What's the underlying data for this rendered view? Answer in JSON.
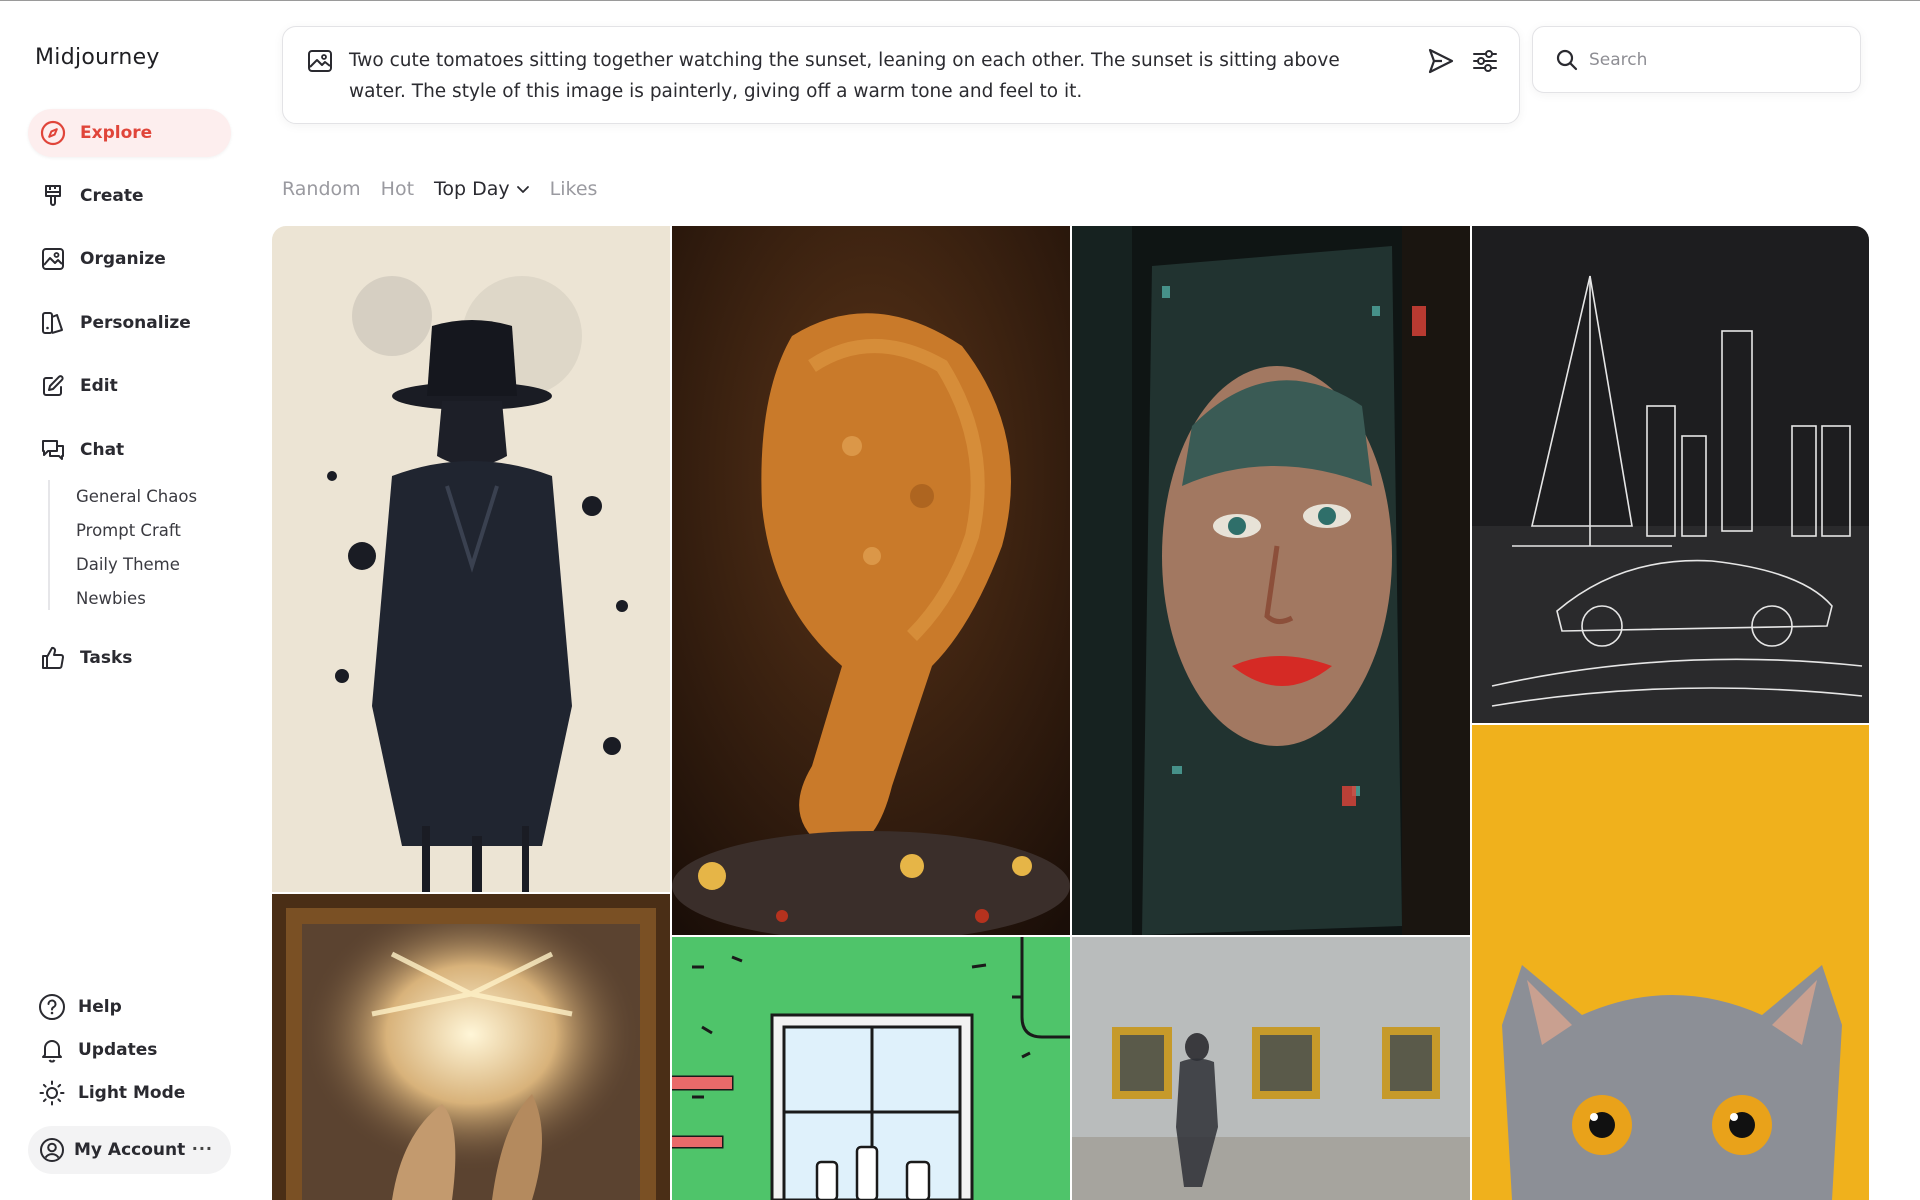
{
  "brand": "Midjourney",
  "nav": [
    {
      "label": "Explore",
      "icon": "compass-icon",
      "active": true
    },
    {
      "label": "Create",
      "icon": "brush-icon"
    },
    {
      "label": "Organize",
      "icon": "image-icon"
    },
    {
      "label": "Personalize",
      "icon": "personalize-icon"
    },
    {
      "label": "Edit",
      "icon": "edit-icon"
    },
    {
      "label": "Chat",
      "icon": "chat-icon"
    }
  ],
  "chat_rooms": [
    "General Chaos",
    "Prompt Craft",
    "Daily Theme",
    "Newbies"
  ],
  "tasks": {
    "label": "Tasks",
    "icon": "thumbs-up-icon"
  },
  "footer": [
    {
      "label": "Help",
      "icon": "help-icon"
    },
    {
      "label": "Updates",
      "icon": "bell-icon"
    },
    {
      "label": "Light Mode",
      "icon": "sun-icon"
    }
  ],
  "account": {
    "label": "My Account",
    "more": "···",
    "icon": "user-circle-icon"
  },
  "prompt": {
    "text": "Two cute tomatoes sitting together watching the sunset, leaning on each other. The sunset is sitting above water. The style of this image is painterly, giving off a warm tone and feel to it.",
    "icon_image": "image-icon",
    "icon_send": "send-icon",
    "icon_settings": "sliders-icon"
  },
  "search": {
    "placeholder": "Search",
    "value": ""
  },
  "tabs": [
    {
      "label": "Random"
    },
    {
      "label": "Hot"
    },
    {
      "label": "Top Day",
      "active": true,
      "dropdown": true
    },
    {
      "label": "Likes"
    }
  ],
  "colors": {
    "accent": "#e0453a",
    "active_bg": "#fdeeee"
  },
  "gallery": [
    {
      "name": "gallery-image-ink-splash-man-in-hat"
    },
    {
      "name": "gallery-image-fried-chicken-drumstick"
    },
    {
      "name": "gallery-image-digital-mosaic-woman-face"
    },
    {
      "name": "gallery-image-wireframe-sailboat-car-skyline"
    },
    {
      "name": "gallery-image-baroque-angel-painting"
    },
    {
      "name": "gallery-image-cartoon-window-shelf"
    },
    {
      "name": "gallery-image-gallery-walking-person"
    },
    {
      "name": "gallery-image-grey-cat-yellow-background"
    }
  ]
}
